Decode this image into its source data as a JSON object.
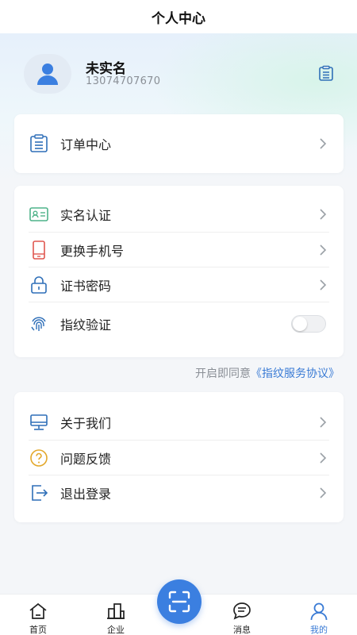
{
  "header": {
    "title": "个人中心"
  },
  "profile": {
    "name": "未实名",
    "phone": "13074707670",
    "avatar_icon": "user-avatar-icon",
    "note_icon": "document-icon"
  },
  "card_orders": {
    "items": [
      {
        "label": "订单中心",
        "icon": "order-list-icon"
      }
    ]
  },
  "card_account": {
    "items": [
      {
        "label": "实名认证",
        "icon": "id-card-icon"
      },
      {
        "label": "更换手机号",
        "icon": "phone-icon"
      },
      {
        "label": "证书密码",
        "icon": "lock-icon"
      },
      {
        "label": "指纹验证",
        "icon": "fingerprint-icon",
        "toggle_on": false
      }
    ]
  },
  "agreement": {
    "prefix": "开启即同意",
    "link": "《指纹服务协议》"
  },
  "card_more": {
    "items": [
      {
        "label": "关于我们",
        "icon": "monitor-icon"
      },
      {
        "label": "问题反馈",
        "icon": "question-icon"
      },
      {
        "label": "退出登录",
        "icon": "logout-icon"
      }
    ]
  },
  "tabbar": {
    "tabs": [
      {
        "label": "首页",
        "icon": "home-icon",
        "active": false
      },
      {
        "label": "企业",
        "icon": "building-icon",
        "active": false
      },
      {
        "label": "消息",
        "icon": "message-icon",
        "active": false
      },
      {
        "label": "我的",
        "icon": "person-icon",
        "active": true
      }
    ],
    "scan_icon": "scan-icon"
  },
  "colors": {
    "accent": "#3a7bd5",
    "scan_button": "#3b7fe0",
    "background": "#f4f6f9",
    "icon_green": "#4fb38a",
    "icon_red": "#e0564f",
    "icon_blue": "#2f6fb8"
  }
}
